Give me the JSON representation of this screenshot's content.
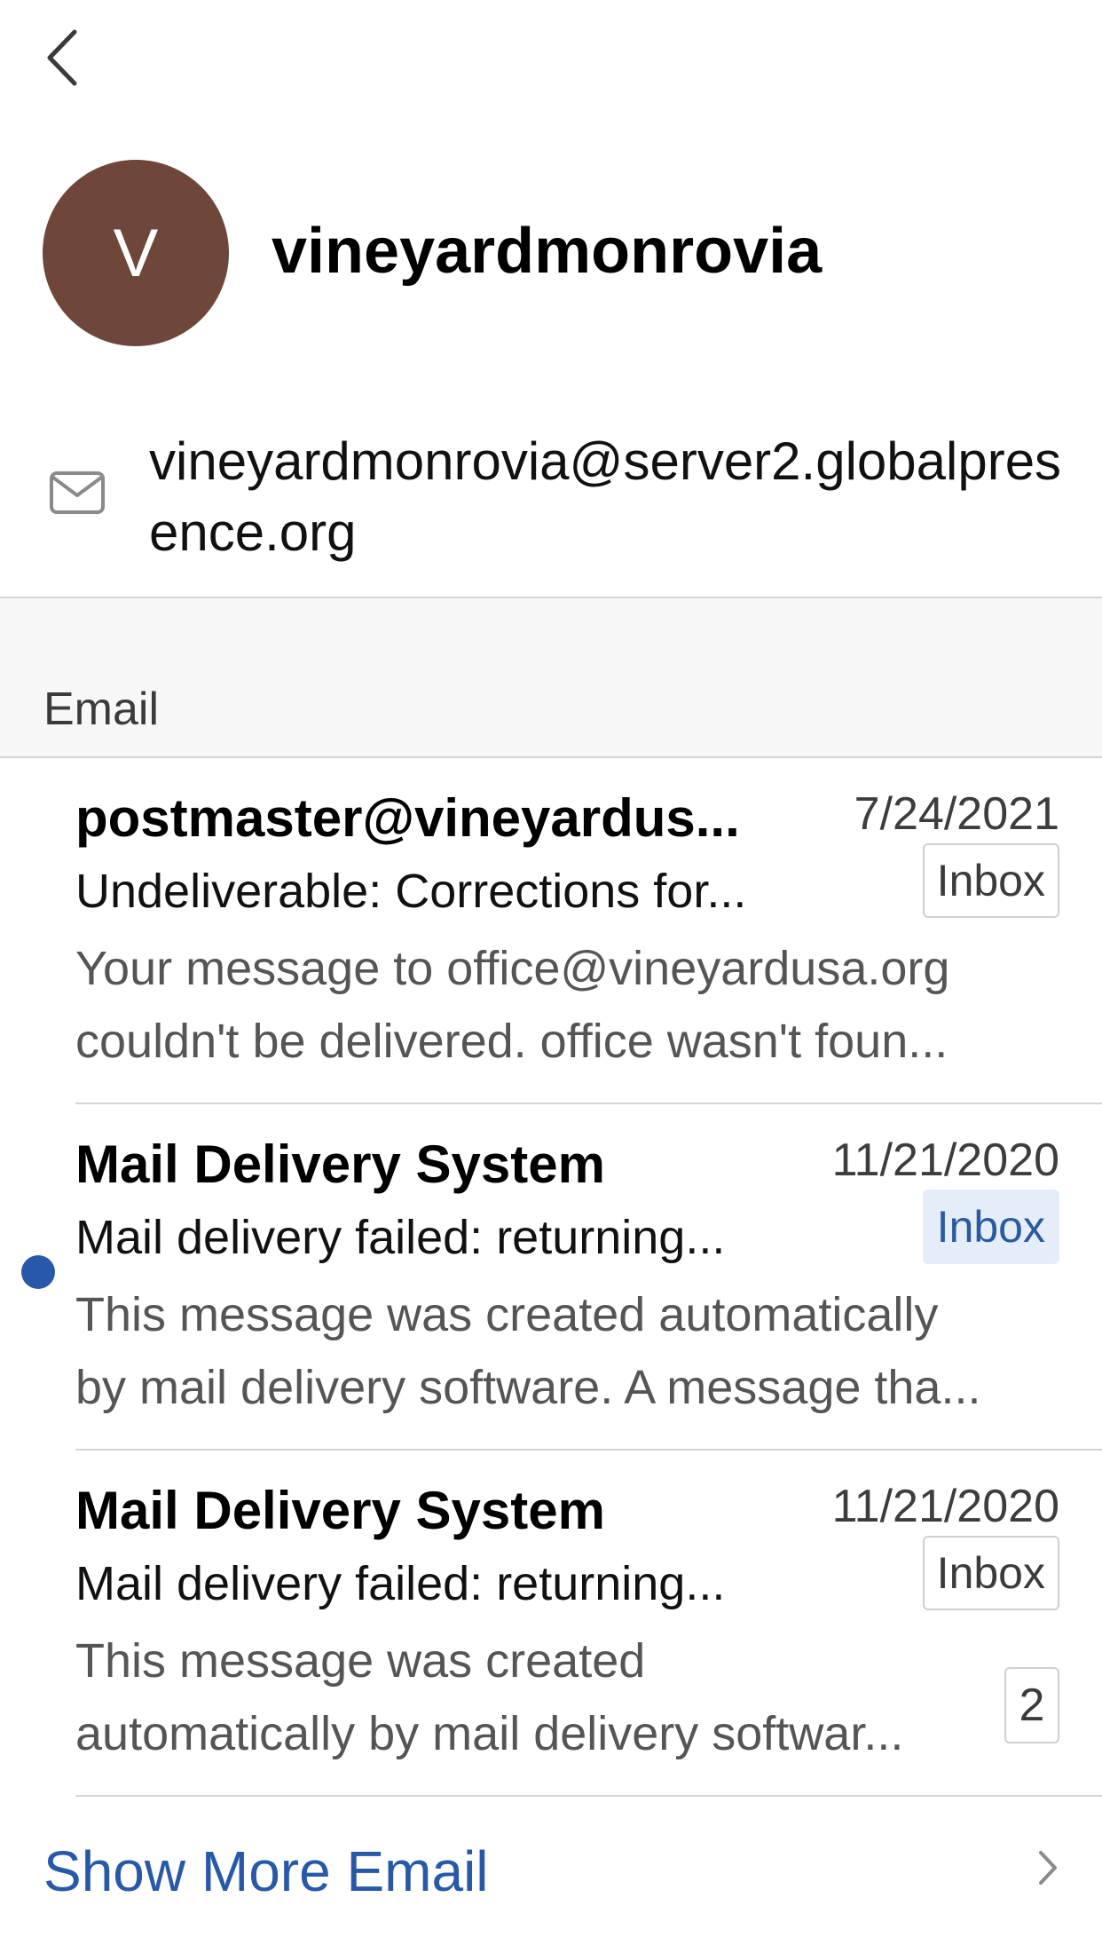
{
  "header": {
    "back_icon": "chevron-left-icon"
  },
  "contact": {
    "avatar_initial": "V",
    "avatar_color": "#6e473a",
    "name": "vineyardmonrovia",
    "email_icon": "envelope-icon",
    "email": "vineyardmonrovia@server2.globalpresence.org"
  },
  "section": {
    "title": "Email"
  },
  "messages": [
    {
      "sender": "postmaster@vineyardus...",
      "date": "7/24/2021",
      "subject": "Undeliverable: Corrections for...",
      "folder": "Inbox",
      "preview_line1": "Your message to office@vineyardusa.org",
      "preview_line2": "couldn't be delivered. office wasn't foun...",
      "unread": false
    },
    {
      "sender": "Mail Delivery System",
      "date": "11/21/2020",
      "subject": "Mail delivery failed: returning...",
      "folder": "Inbox",
      "preview_line1": "This message was created automatically",
      "preview_line2": "by mail delivery software. A message tha...",
      "unread": true
    },
    {
      "sender": "Mail Delivery System",
      "date": "11/21/2020",
      "subject": "Mail delivery failed: returning...",
      "folder": "Inbox",
      "preview_line1": "This message was created",
      "preview_line2": "automatically by mail delivery softwar...",
      "thread_count": "2",
      "unread": false
    }
  ],
  "footer": {
    "show_more_label": "Show More Email",
    "chevron_icon": "chevron-right-icon"
  },
  "colors": {
    "accent": "#2859a8",
    "unread_badge_bg": "#e5eef8",
    "section_bg": "#f7f7f7"
  }
}
